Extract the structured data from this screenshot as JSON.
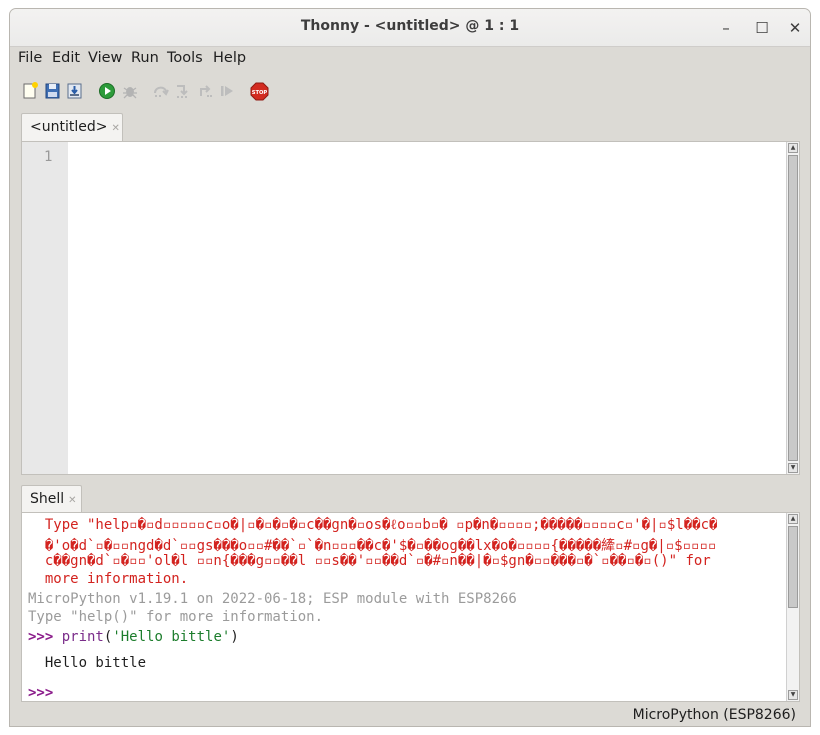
{
  "window": {
    "title": "Thonny  -  <untitled>  @  1 : 1"
  },
  "menu": [
    "File",
    "Edit",
    "View",
    "Run",
    "Tools",
    "Help"
  ],
  "toolbar": {
    "icons": [
      "new-file-icon",
      "open-file-icon",
      "save-file-icon",
      "run-icon",
      "debug-icon",
      "step-over-icon",
      "step-into-icon",
      "step-out-icon",
      "resume-icon",
      "stop-icon"
    ],
    "stop_label": "STOP"
  },
  "editor": {
    "tab_label": "<untitled>",
    "line_numbers": [
      "1"
    ]
  },
  "shell": {
    "tab_label": "Shell",
    "lines": [
      {
        "text": "  Type \"help▫�▫d▫▫▫▫▫c▫o�|▫�▫�▫�▫c��gn�▫os�ℓo▫▫b▫� ▫p�n�▫▫▫▫;�����▫▫▫▫c▫'�|▫$l��c�",
        "cls": "err"
      },
      {
        "text": "  �'o�d`▫�▫▫ngd�d`▫▫gs���o▫▫#��`▫`�n▫▫▫��c�'$�▫��og��lx�o�▫▫▫▫{�����縴▫#▫g�|▫$▫▫▫▫",
        "cls": "err"
      },
      {
        "text": "  c��gn�d`▫�▫▫'ol�l ▫▫n{���g▫▫��l ▫▫s��'▫▫��d`▫�#▫n��|�▫$gn�▫▫���▫�`▫��▫�▫()\" for",
        "cls": "err"
      },
      {
        "text": "  more information.",
        "cls": "err"
      },
      {
        "text": "MicroPython v1.19.1 on 2022-06-18; ESP module with ESP8266",
        "cls": "grey"
      },
      {
        "text": "Type \"help()\" for more information.",
        "cls": "grey"
      }
    ],
    "command": {
      "prompt": ">>> ",
      "func": "print",
      "open": "(",
      "arg": "'Hello bittle'",
      "close": ")"
    },
    "output": "  Hello bittle",
    "final_prompt": ">>>"
  },
  "status": {
    "interpreter": "MicroPython (ESP8266)"
  }
}
